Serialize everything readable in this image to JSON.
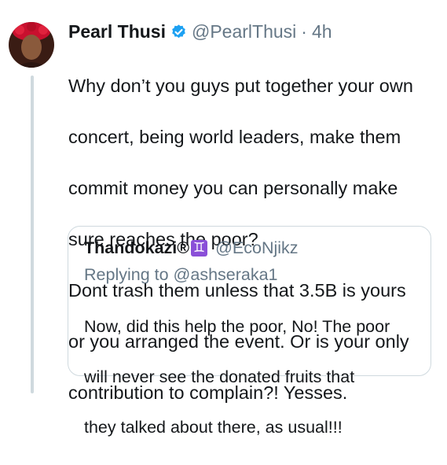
{
  "tweet": {
    "display_name": "Pearl Thusi",
    "handle": "@PearlThusi",
    "separator": "·",
    "time": "4h",
    "text_lines": [
      "Why don’t you guys put together your own",
      "concert, being world leaders, make them",
      "commit money you can personally make",
      "sure reaches the poor?",
      "Dont trash them unless that 3.5B is yours",
      "or you arranged the event. Or is your only",
      "contribution to complain?! Yesses."
    ]
  },
  "quote": {
    "display_name": "Thandokazi®",
    "badge": "♊",
    "handle": "@EcoNjikz",
    "replying_to": "Replying to @ashseraka1",
    "text_lines": [
      "Now, did this help the poor, No! The poor",
      "will never see the donated fruits that",
      "they talked about there, as usual!!!"
    ]
  },
  "colors": {
    "verified": "#1da1f2",
    "secondary_text": "#657786",
    "badge": "#8a4fd8",
    "border": "#cfd9de"
  },
  "icons": [
    "verified-badge-icon",
    "gemini-emoji-icon"
  ]
}
